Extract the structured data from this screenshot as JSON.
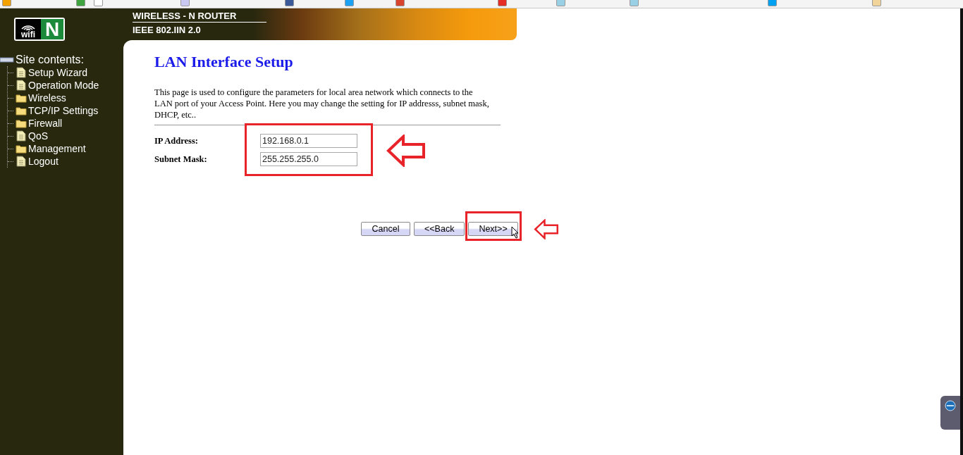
{
  "header": {
    "title": "WIRELESS - N ROUTER",
    "subtitle": "IEEE 802.IIN 2.0",
    "logo_letter": "N",
    "logo_word": "wifi"
  },
  "sidebar": {
    "heading": "Site contents:",
    "items": [
      {
        "label": "Setup Wizard",
        "kind": "page"
      },
      {
        "label": "Operation Mode",
        "kind": "page"
      },
      {
        "label": "Wireless",
        "kind": "folder"
      },
      {
        "label": "TCP/IP Settings",
        "kind": "folder"
      },
      {
        "label": "Firewall",
        "kind": "folder"
      },
      {
        "label": "QoS",
        "kind": "page"
      },
      {
        "label": "Management",
        "kind": "folder"
      },
      {
        "label": "Logout",
        "kind": "page"
      }
    ]
  },
  "page": {
    "title": "LAN Interface Setup",
    "description": "This page is used to configure the parameters for local area network which connects to the LAN port of your Access Point. Here you may change the setting for IP addresss, subnet mask, DHCP, etc..",
    "form": {
      "highlighted": true,
      "fields": [
        {
          "label": "IP Address:",
          "value": "192.168.0.1"
        },
        {
          "label": "Subnet Mask:",
          "value": "255.255.255.0"
        }
      ]
    },
    "buttons": [
      {
        "label": "Cancel",
        "highlighted": false
      },
      {
        "label": "<<Back",
        "highlighted": false
      },
      {
        "label": "Next>>",
        "highlighted": true
      }
    ]
  }
}
